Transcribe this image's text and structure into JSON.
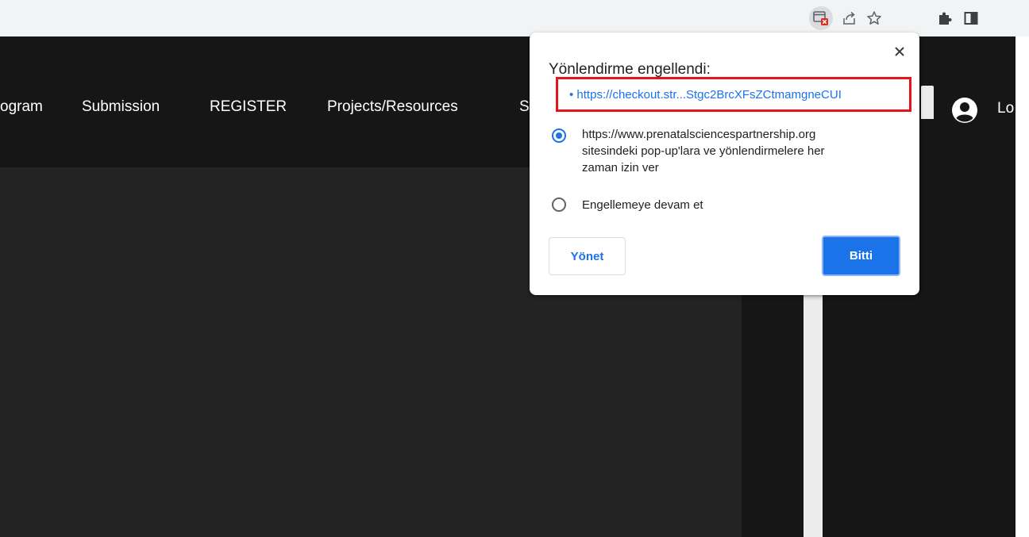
{
  "toolbar": {
    "icons": [
      "popup-blocked-icon",
      "share-icon",
      "bookmark-star-icon",
      "extensions-puzzle-icon",
      "side-panel-icon"
    ]
  },
  "site": {
    "nav": [
      "ogram",
      "Submission",
      "REGISTER",
      "Projects/Resources",
      "S"
    ],
    "login_label": "Lo"
  },
  "popup": {
    "title": "Yönlendirme engellendi:",
    "blocked_url": "• https://checkout.str...Stgc2BrcXFsZCtmamgneCUI",
    "option_allow_line1": "https://www.prenatalsciencespartnership.org",
    "option_allow_line2": "sitesindeki pop-up'lara ve yönlendirmelere her",
    "option_allow_line3": "zaman izin ver",
    "option_block": "Engellemeye devam et",
    "manage_label": "Yönet",
    "done_label": "Bitti"
  },
  "colors": {
    "accent": "#1a73e8",
    "highlight_border": "#e8131a",
    "navbar": "#161616",
    "hero": "#232323"
  }
}
